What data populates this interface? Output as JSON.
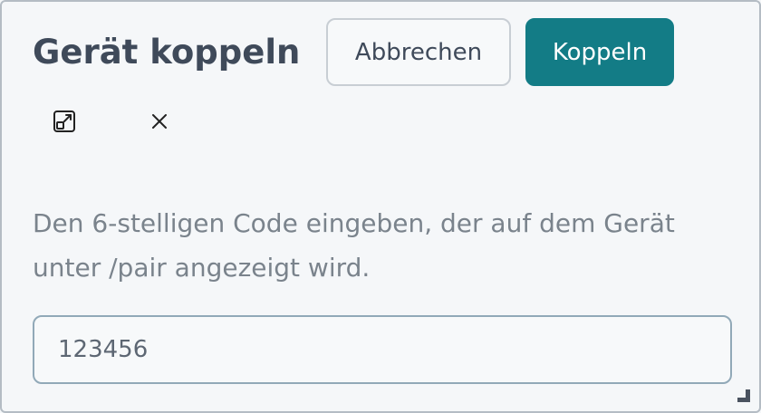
{
  "dialog": {
    "title": "Gerät koppeln",
    "cancel_label": "Abbrechen",
    "pair_label": "Koppeln",
    "popout_icon": "popout-icon",
    "close_icon": "close-icon",
    "description": "Den 6-stelligen Code eingeben, der auf dem Gerät unter /pair angezeigt wird.",
    "code_input": {
      "value": "123456",
      "placeholder": ""
    }
  },
  "colors": {
    "primary": "#137c86",
    "background": "#f5f7f9",
    "text": "#3f4a5a",
    "muted_text": "#7a838c",
    "input_border": "#91a9b8"
  }
}
